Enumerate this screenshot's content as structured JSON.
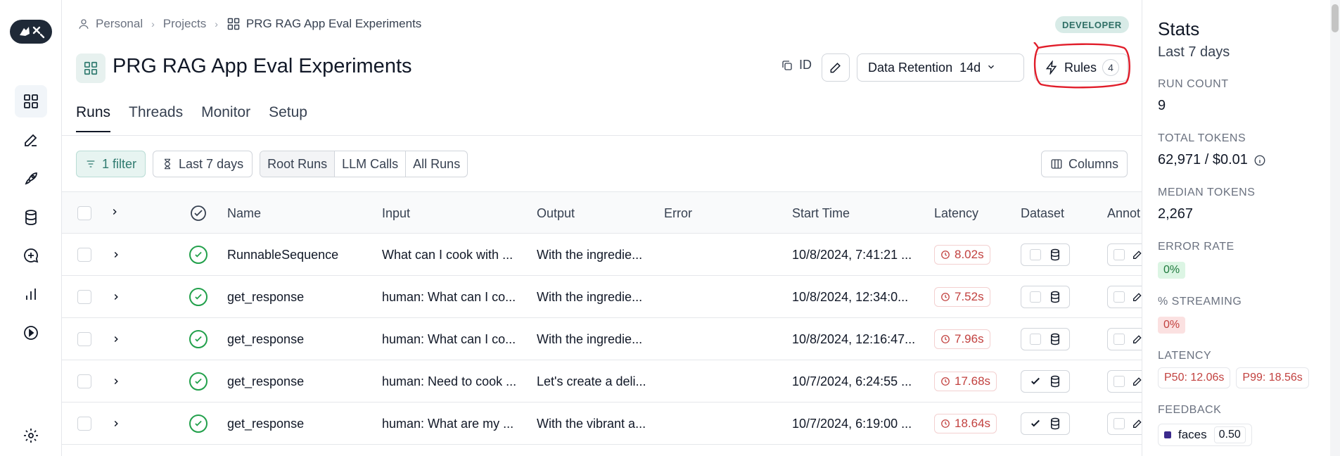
{
  "breadcrumb": {
    "personal": "Personal",
    "projects": "Projects",
    "current": "PRG RAG App Eval Experiments"
  },
  "badge": "DEVELOPER",
  "page_title": "PRG RAG App Eval Experiments",
  "header": {
    "id_label": "ID",
    "retention_label": "Data Retention",
    "retention_value": "14d",
    "rules_label": "Rules",
    "rules_count": "4"
  },
  "tabs": [
    "Runs",
    "Threads",
    "Monitor",
    "Setup"
  ],
  "filters": {
    "filter_label": "1 filter",
    "range_label": "Last 7 days",
    "segments": [
      "Root Runs",
      "LLM Calls",
      "All Runs"
    ],
    "columns_label": "Columns"
  },
  "table": {
    "headers": [
      "Name",
      "Input",
      "Output",
      "Error",
      "Start Time",
      "Latency",
      "Dataset",
      "Annot"
    ],
    "rows": [
      {
        "name": "RunnableSequence",
        "input": "What can I cook with ...",
        "output": "With the ingredie...",
        "error": "",
        "start": "10/8/2024, 7:41:21 ...",
        "latency": "8.02s",
        "in_dataset": false
      },
      {
        "name": "get_response",
        "input": "human: What can I co...",
        "output": "With the ingredie...",
        "error": "",
        "start": "10/8/2024, 12:34:0...",
        "latency": "7.52s",
        "in_dataset": false
      },
      {
        "name": "get_response",
        "input": "human: What can I co...",
        "output": "With the ingredie...",
        "error": "",
        "start": "10/8/2024, 12:16:47...",
        "latency": "7.96s",
        "in_dataset": false
      },
      {
        "name": "get_response",
        "input": "human: Need to cook ...",
        "output": "Let's create a deli...",
        "error": "",
        "start": "10/7/2024, 6:24:55 ...",
        "latency": "17.68s",
        "in_dataset": true
      },
      {
        "name": "get_response",
        "input": "human: What are my ...",
        "output": "With the vibrant a...",
        "error": "",
        "start": "10/7/2024, 6:19:00 ...",
        "latency": "18.64s",
        "in_dataset": true
      }
    ]
  },
  "stats": {
    "title": "Stats",
    "subtitle": "Last 7 days",
    "run_count_label": "RUN COUNT",
    "run_count": "9",
    "total_tokens_label": "TOTAL TOKENS",
    "total_tokens": "62,971 / $0.01",
    "median_tokens_label": "MEDIAN TOKENS",
    "median_tokens": "2,267",
    "error_rate_label": "ERROR RATE",
    "error_rate": "0%",
    "streaming_label": "% STREAMING",
    "streaming": "0%",
    "latency_label": "LATENCY",
    "p50": "P50: 12.06s",
    "p99": "P99: 18.56s",
    "feedback_label": "FEEDBACK",
    "feedback_key": "faces",
    "feedback_value": "0.50"
  },
  "colors": {
    "accent": "#2f7a6f",
    "success": "#22a04b",
    "danger": "#c2413f",
    "annotation": "#e11d2a"
  },
  "icons": [
    "app-logo",
    "grid-icon",
    "pencil-icon",
    "rocket-icon",
    "database-icon",
    "chat-plus-icon",
    "bar-chart-icon",
    "play-circle-icon",
    "gear-icon"
  ]
}
